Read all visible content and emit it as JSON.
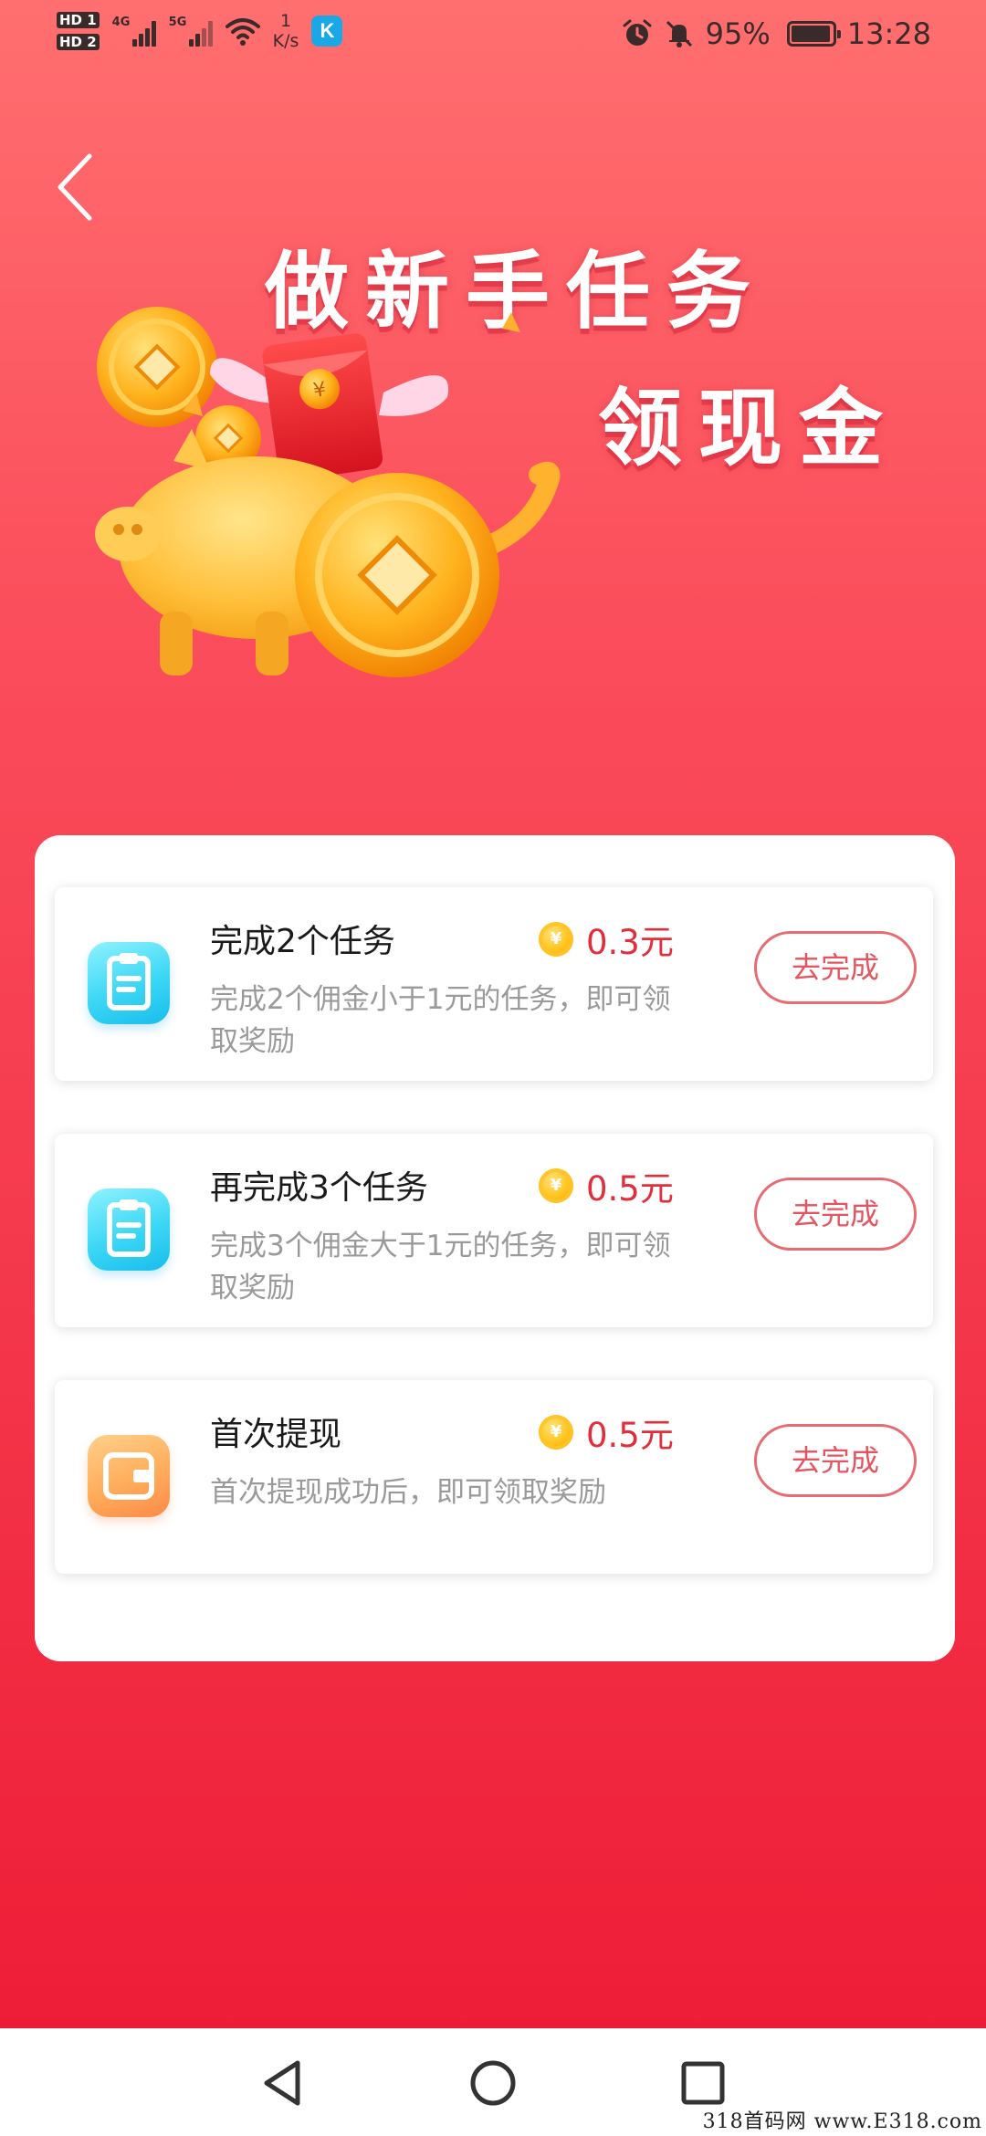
{
  "status_bar": {
    "hd1": "HD 1",
    "hd2": "HD 2",
    "net1": "4G",
    "net2": "5G",
    "speed_value": "1",
    "speed_unit": "K/s",
    "app_badge": "K",
    "battery": "95%",
    "battery_level": 0.95,
    "time": "13:28"
  },
  "banner": {
    "title_line1": "做新手任务",
    "title_line2": "领现金",
    "coin_symbol": "¥"
  },
  "tasks": [
    {
      "title": "完成2个任务",
      "reward": "0.3元",
      "description": "完成2个佣金小于1元的任务，即可领取奖励",
      "button": "去完成",
      "icon": "clipboard-icon"
    },
    {
      "title": "再完成3个任务",
      "reward": "0.5元",
      "description": "完成3个佣金大于1元的任务，即可领取奖励",
      "button": "去完成",
      "icon": "clipboard-icon"
    },
    {
      "title": "首次提现",
      "reward": "0.5元",
      "description": "首次提现成功后，即可领取奖励",
      "button": "去完成",
      "icon": "wallet-icon"
    }
  ],
  "coin_symbol": "¥",
  "watermark": "318首码网 www.E318.com",
  "colors": {
    "accent": "#e12d3c",
    "button_border": "#e66b73",
    "background_top": "#ff6f70",
    "background_bottom": "#ee1d37"
  }
}
